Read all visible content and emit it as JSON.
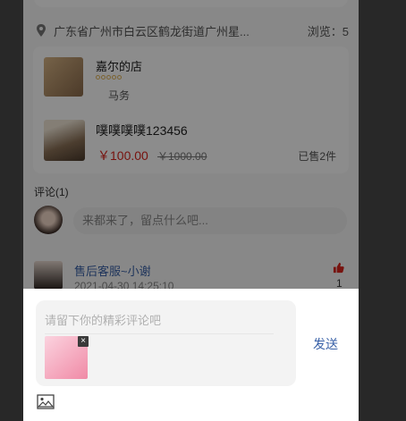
{
  "location": {
    "address": "广东省广州市白云区鹤龙街道广州星...",
    "views": "浏览：5"
  },
  "shop": {
    "name": "嘉尔的店",
    "service": "马务"
  },
  "product": {
    "name": "噗噗噗噗123456",
    "price": "￥100.00",
    "original_price": "￥1000.00",
    "sold": "已售2件"
  },
  "comments": {
    "title": "评论(1)",
    "input_placeholder": "来都来了，留点什么吧...",
    "items": [
      {
        "user": "售后客服~小谢",
        "time": "2021-04-30 14:25:10",
        "likes": "1"
      }
    ]
  },
  "reply_sheet": {
    "placeholder": "请留下你的精彩评论吧",
    "send_label": "发送",
    "thumb_close": "×"
  },
  "colors": {
    "accent": "#3a62a8",
    "price": "#d9241c",
    "like": "#d9241c"
  }
}
